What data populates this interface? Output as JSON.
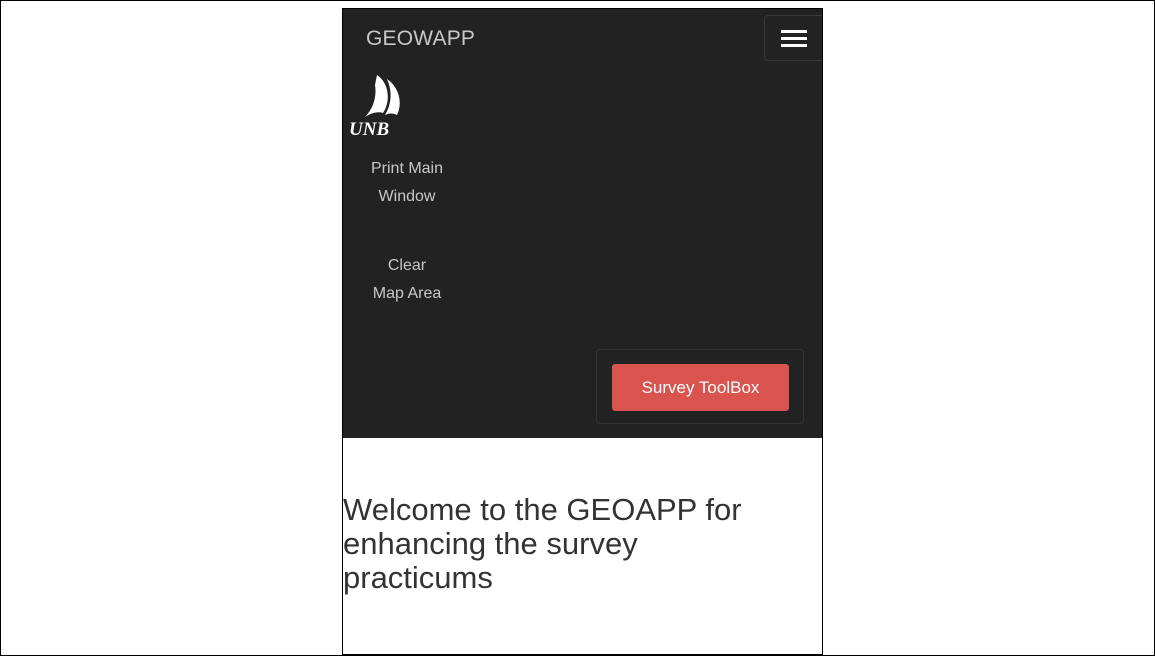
{
  "navbar": {
    "brand": "GEOWAPP",
    "toggle_icon": "hamburger-menu-icon",
    "logo": {
      "text": "UNB",
      "icon": "sail-logo-icon",
      "color": "#ffffff"
    },
    "links": [
      {
        "line1": "Print Main",
        "line2": "Window"
      },
      {
        "line1": "Clear",
        "line2": "Map Area"
      }
    ],
    "toolbox_button": "Survey ToolBox",
    "background": "#222222"
  },
  "main": {
    "welcome_line1": "Welcome to the GEOAPP for",
    "welcome_line2": "enhancing the survey",
    "welcome_line3": "practicums"
  },
  "colors": {
    "button_danger": "#d9534f",
    "nav_text": "#c8c8c8",
    "body_text": "#333333"
  }
}
